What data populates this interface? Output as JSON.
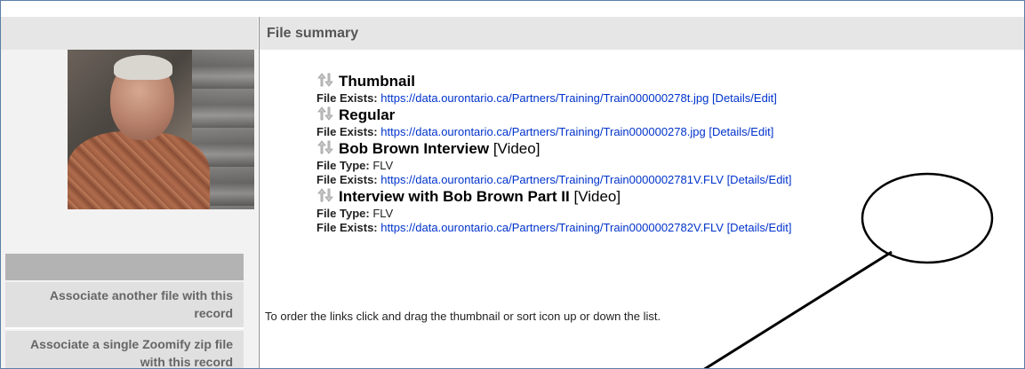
{
  "header": {
    "title": "File summary"
  },
  "sidebar": {
    "items": [
      {
        "label": "Associate another file with this record"
      },
      {
        "label": "Associate a single Zoomify zip file with this record"
      }
    ]
  },
  "files": [
    {
      "name": "Thumbnail",
      "type_tag": "",
      "file_type_label": "",
      "file_type": "",
      "exists_label": "File Exists:",
      "url": "https://data.ourontario.ca/Partners/Training/Train000000278t.jpg",
      "action": "[Details/Edit]"
    },
    {
      "name": "Regular",
      "type_tag": "",
      "file_type_label": "",
      "file_type": "",
      "exists_label": "File Exists:",
      "url": "https://data.ourontario.ca/Partners/Training/Train000000278.jpg",
      "action": "[Details/Edit]"
    },
    {
      "name": "Bob Brown Interview",
      "type_tag": "[Video]",
      "file_type_label": "File Type:",
      "file_type": "FLV",
      "exists_label": "File Exists:",
      "url": "https://data.ourontario.ca/Partners/Training/Train0000002781V.FLV",
      "action": "[Details/Edit]"
    },
    {
      "name": "Interview with Bob Brown Part II",
      "type_tag": "[Video]",
      "file_type_label": "File Type:",
      "file_type": "FLV",
      "exists_label": "File Exists:",
      "url": "https://data.ourontario.ca/Partners/Training/Train0000002782V.FLV",
      "action": "[Details/Edit]"
    }
  ],
  "instruction": "To order the links click and drag the thumbnail or sort icon up or down the list.",
  "icons": {
    "sort": "sort-arrows-icon"
  },
  "colors": {
    "link": "#0033cc",
    "header_bg": "#e6e6e6",
    "sidebar_item_bg": "#e0e0e0",
    "border": "#5b7fa6"
  }
}
